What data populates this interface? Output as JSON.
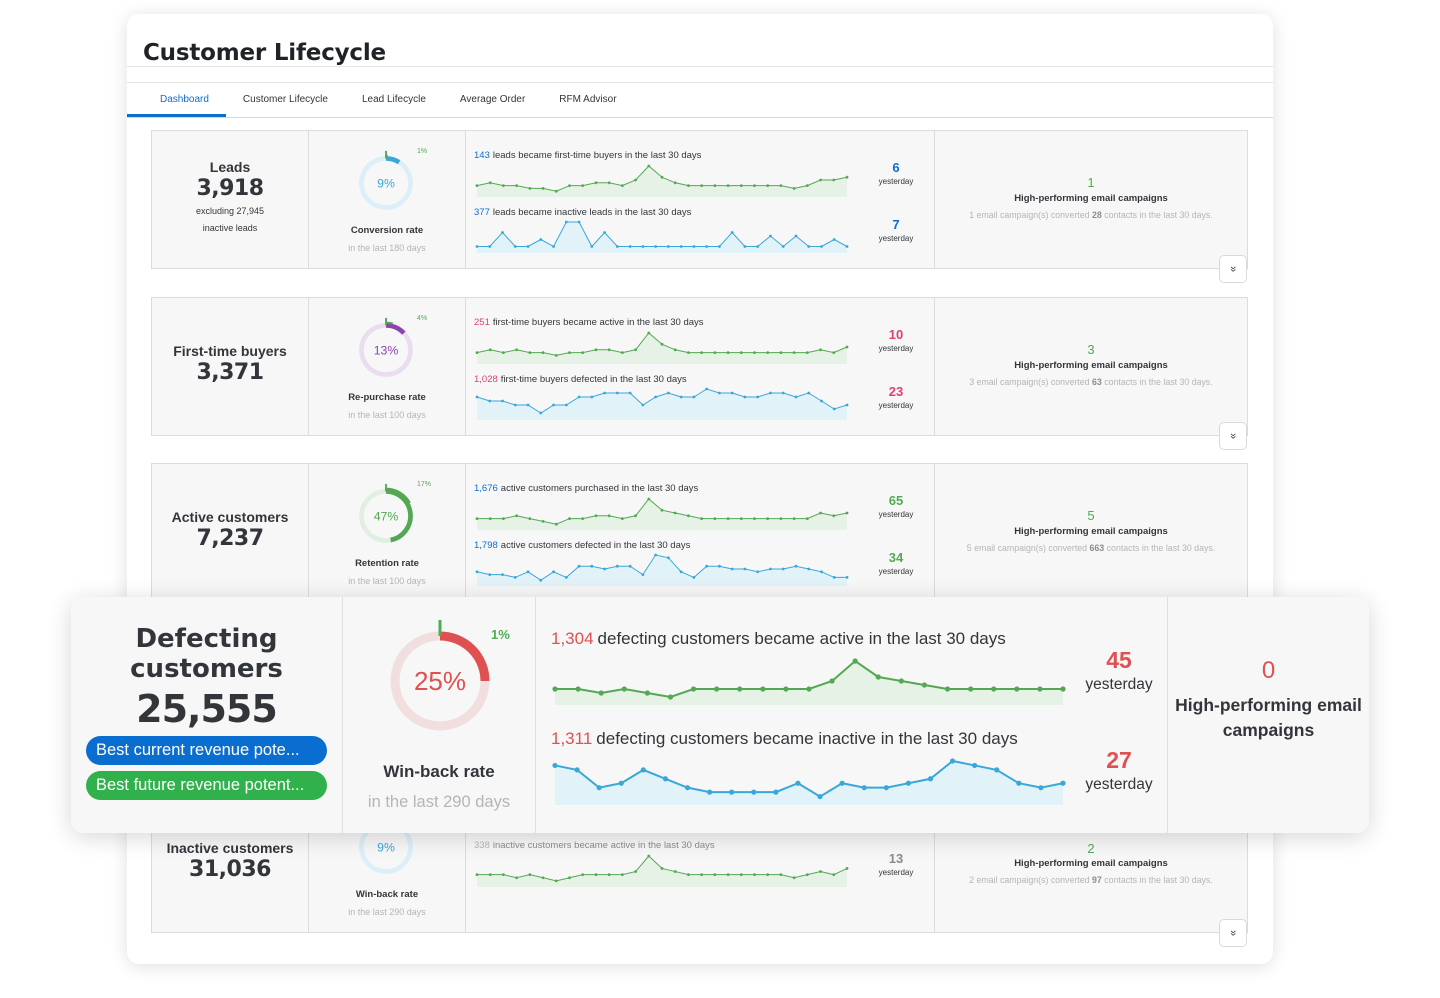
{
  "page_title": "Customer Lifecycle",
  "tabs": [
    {
      "label": "Dashboard",
      "active": true
    },
    {
      "label": "Customer Lifecycle"
    },
    {
      "label": "Lead Lifecycle"
    },
    {
      "label": "Average Order"
    },
    {
      "label": "RFM Advisor"
    }
  ],
  "expand_glyph": "»",
  "campaign_label": "High-performing email campaigns",
  "yesterday_label": "yesterday",
  "colors": {
    "blue": "#0a6ed1",
    "green": "#54a854",
    "red": "#e05050",
    "purple": "#8e44ad",
    "pink": "#e0406e",
    "teal": "#3ba7d8"
  },
  "segments": [
    {
      "name": "Leads",
      "count": "3,918",
      "note1": "excluding 27,945",
      "note2": "inactive leads",
      "rate_pct": "9%",
      "rate_value": 0.09,
      "rate_color": "#3ba7d8",
      "small_pct": "1%",
      "small_value": 0.01,
      "rate_label": "Conversion rate",
      "rate_period": "in the last 180 days",
      "metric1": {
        "num": "143",
        "num_color": "#0a6ed1",
        "text": "leads became first-time buyers in the last 30 days",
        "yesterday": "6",
        "y_color": "#0a6ed1",
        "values": [
          3,
          4,
          3,
          3,
          2,
          2,
          1,
          3,
          3,
          4,
          4,
          3,
          5,
          10,
          6,
          4,
          3,
          3,
          3,
          3,
          3,
          3,
          3,
          3,
          2,
          3,
          5,
          5,
          6
        ]
      },
      "metric2": {
        "num": "377",
        "num_color": "#0a6ed1",
        "text": "leads became inactive leads in the last 30 days",
        "yesterday": "7",
        "y_color": "#0a6ed1",
        "values": [
          1,
          1,
          5,
          1,
          1,
          3,
          1,
          8,
          8,
          1,
          5,
          1,
          1,
          1,
          1,
          1,
          1,
          1,
          1,
          1,
          5,
          1,
          1,
          4,
          1,
          4,
          1,
          1,
          3,
          1
        ]
      }
    },
    {
      "name": "First-time buyers",
      "count": "3,371",
      "rate_pct": "13%",
      "rate_value": 0.13,
      "rate_color": "#8e44ad",
      "small_pct": "4%",
      "small_value": 0.04,
      "rate_label": "Re-purchase rate",
      "rate_period": "in the last 100 days",
      "metric1": {
        "num": "251",
        "num_color": "#e0406e",
        "text": "first-time buyers became active in the last 30 days",
        "yesterday": "10",
        "y_color": "#e0406e",
        "values": [
          3,
          4,
          3,
          4,
          3,
          3,
          2,
          3,
          3,
          4,
          4,
          3,
          4,
          10,
          6,
          4,
          3,
          3,
          3,
          3,
          3,
          3,
          3,
          3,
          3,
          3,
          4,
          3,
          5
        ]
      },
      "metric2": {
        "num": "1,028",
        "num_color": "#e0406e",
        "text": "first-time buyers defected in the last 30 days",
        "yesterday": "23",
        "y_color": "#e0406e",
        "values": [
          5,
          4,
          4,
          3,
          3,
          1,
          3,
          3,
          5,
          5,
          6,
          6,
          6,
          3,
          5,
          6,
          5,
          5,
          7,
          6,
          6,
          5,
          5,
          6,
          6,
          5,
          6,
          4,
          2,
          3
        ]
      }
    },
    {
      "name": "Active customers",
      "count": "7,237",
      "rate_pct": "47%",
      "rate_value": 0.47,
      "rate_color": "#54a854",
      "small_pct": "17%",
      "small_value": 0.17,
      "rate_label": "Retention rate",
      "rate_period": "in the last 100 days",
      "metric1": {
        "num": "1,676",
        "num_color": "#0a6ed1",
        "text": "active customers purchased in the last 30 days",
        "yesterday": "65",
        "y_color": "#54a854",
        "values": [
          3,
          3,
          3,
          4,
          3,
          2,
          1,
          3,
          3,
          4,
          4,
          3,
          4,
          10,
          6,
          5,
          4,
          3,
          3,
          3,
          3,
          3,
          3,
          3,
          3,
          3,
          5,
          4,
          5
        ]
      },
      "metric2": {
        "num": "1,798",
        "num_color": "#0a6ed1",
        "text": "active customers defected in the last 30 days",
        "yesterday": "34",
        "y_color": "#54a854",
        "values": [
          4,
          3,
          3,
          2,
          4,
          1,
          4,
          2,
          6,
          6,
          5,
          6,
          6,
          3,
          10,
          9,
          4,
          2,
          6,
          6,
          5,
          5,
          4,
          5,
          5,
          6,
          5,
          4,
          2,
          2
        ]
      }
    },
    {
      "name": "Inactive customers",
      "count": "31,036",
      "rate_pct": "9%",
      "rate_value": 0.09,
      "rate_color": "#3ba7d8",
      "small_pct": "",
      "small_value": 0,
      "rate_label": "Win-back rate",
      "rate_period": "in the last 290 days",
      "metric1": {
        "num": "338",
        "num_color": "#b5b5b5",
        "text": "inactive customers became active in the last 30 days",
        "yesterday": "13",
        "y_color": "#8c8c8c",
        "values": [
          3,
          3,
          3,
          2,
          3,
          2,
          1,
          2,
          3,
          3,
          3,
          3,
          4,
          9,
          5,
          4,
          3,
          3,
          3,
          3,
          3,
          3,
          3,
          3,
          2,
          3,
          4,
          3,
          5
        ]
      },
      "campaigns": "2",
      "campaign_contacts": "97"
    }
  ],
  "campaigns": [
    {
      "count": "1",
      "desc_pre": "1 email campaign(s) converted",
      "contacts": "28",
      "desc_post": "contacts in the last 30 days."
    },
    {
      "count": "3",
      "desc_pre": "3 email campaign(s) converted",
      "contacts": "63",
      "desc_post": "contacts in the last 30 days."
    },
    {
      "count": "5",
      "desc_pre": "5 email campaign(s) converted",
      "contacts": "663",
      "desc_post": "contacts in the last 30 days."
    },
    {
      "count": "2",
      "desc_pre": "2 email campaign(s) converted",
      "contacts": "97",
      "desc_post": "contacts in the last 30 days."
    }
  ],
  "overlay": {
    "name": "Defecting customers",
    "count": "25,555",
    "pill_blue": "Best current revenue pote...",
    "pill_green": "Best future revenue potent...",
    "rate_pct": "25%",
    "rate_value": 0.25,
    "small_pct": "1%",
    "small_value": 0.01,
    "rate_label": "Win-back rate",
    "rate_period": "in the last 290 days",
    "metric1": {
      "num": "1,304",
      "text": "defecting customers became active in the last 30 days",
      "yesterday": "45",
      "values": [
        3,
        3,
        2,
        3,
        2,
        1,
        3,
        3,
        3,
        3,
        3,
        3,
        5,
        10,
        6,
        5,
        4,
        3,
        3,
        3,
        3,
        3,
        3
      ]
    },
    "metric2": {
      "num": "1,311",
      "text": "defecting customers became inactive in the last 30 days",
      "yesterday": "27",
      "values": [
        8,
        7,
        3,
        4,
        7,
        5,
        3,
        2,
        2,
        2,
        2,
        4,
        1,
        4,
        3,
        3,
        4,
        5,
        9,
        8,
        7,
        4,
        3,
        4
      ]
    },
    "campaign_count": "0",
    "campaign_label": "High-performing email campaigns"
  }
}
